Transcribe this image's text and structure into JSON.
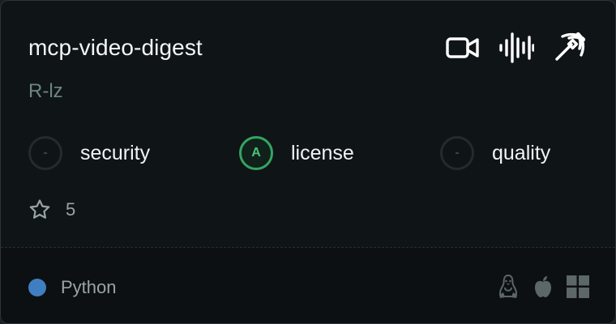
{
  "card": {
    "title": "mcp-video-digest",
    "author": "R-lz",
    "header_icons": [
      "video-camera-icon",
      "audio-waveform-icon",
      "pickaxe-icon"
    ],
    "scores": [
      {
        "badge": "-",
        "label": "security",
        "state": "none"
      },
      {
        "badge": "A",
        "label": "license",
        "state": "grade-a"
      },
      {
        "badge": "-",
        "label": "quality",
        "state": "none"
      }
    ],
    "stars": "5",
    "language": {
      "name": "Python",
      "color": "#3f7ec0"
    },
    "platforms": [
      "linux-icon",
      "apple-icon",
      "windows-icon"
    ]
  }
}
